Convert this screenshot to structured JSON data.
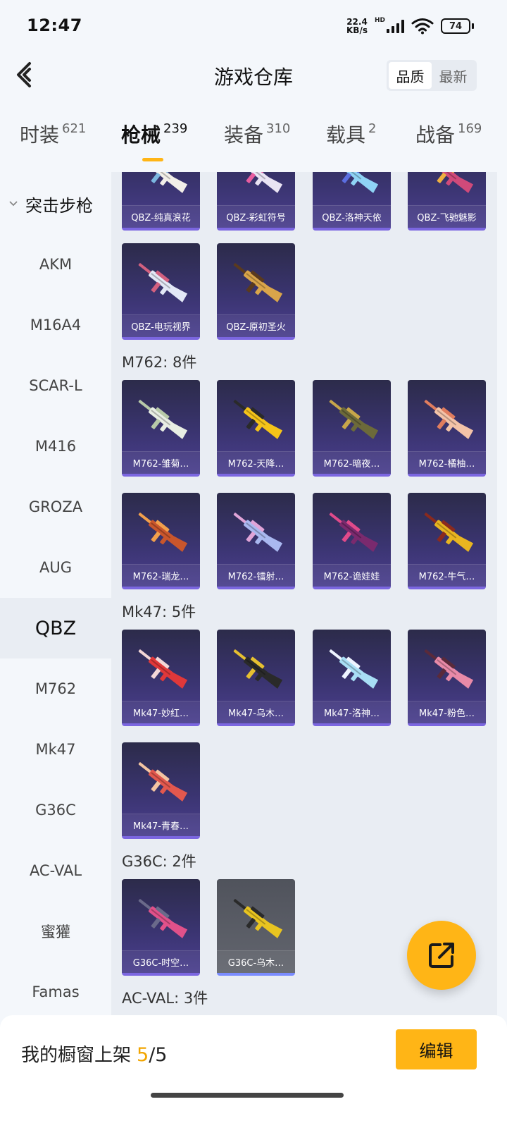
{
  "status": {
    "time": "12:47",
    "net_speed": "22.4",
    "net_unit": "KB/s",
    "net_type": "HD",
    "battery": "74",
    "icons": [
      "signal-icon",
      "wifi-icon",
      "battery-icon"
    ]
  },
  "header": {
    "title": "游戏仓库",
    "sort_options": [
      "品质",
      "最新"
    ],
    "sort_selected": "品质"
  },
  "tabs": [
    {
      "name": "时装",
      "count": "621"
    },
    {
      "name": "枪械",
      "count": "239"
    },
    {
      "name": "装备",
      "count": "310"
    },
    {
      "name": "载具",
      "count": "2"
    },
    {
      "name": "战备",
      "count": "169"
    }
  ],
  "active_tab": "枪械",
  "sidebar": {
    "group": "突击步枪",
    "items": [
      "AKM",
      "M16A4",
      "SCAR-L",
      "M416",
      "GROZA",
      "AUG",
      "QBZ",
      "M762",
      "Mk47",
      "G36C",
      "AC-VAL",
      "蜜獾",
      "Famas"
    ],
    "active": "QBZ"
  },
  "sections": {
    "qbz": {
      "items": [
        "QBZ-纯真浪花",
        "QBZ-彩虹符号",
        "QBZ-洛神天依",
        "QBZ-飞驰魅影",
        "QBZ-电玩视界",
        "QBZ-原初圣火"
      ]
    },
    "m762": {
      "title": "M762: 8件",
      "items": [
        "M762-雏菊…",
        "M762-天降…",
        "M762-暗夜…",
        "M762-橘柚…",
        "M762-瑞龙…",
        "M762-镭射…",
        "M762-诡娃娃",
        "M762-牛气…"
      ]
    },
    "mk47": {
      "title": "Mk47: 5件",
      "items": [
        "Mk47-妙红…",
        "Mk47-乌木…",
        "Mk47-洛神…",
        "Mk47-粉色…",
        "Mk47-青春…"
      ]
    },
    "g36c": {
      "title": "G36C: 2件",
      "items": [
        "G36C-时空…",
        "G36C-乌木…"
      ]
    },
    "acval": {
      "title": "AC-VAL: 3件"
    }
  },
  "bottom": {
    "label": "我的橱窗上架",
    "current": "5",
    "total": "/5",
    "edit": "编辑"
  },
  "colors": {
    "accent": "#ffb516",
    "card_bg": "#3a3470",
    "card_border": "#7b66e0",
    "highlight_count": "#f2a500"
  }
}
